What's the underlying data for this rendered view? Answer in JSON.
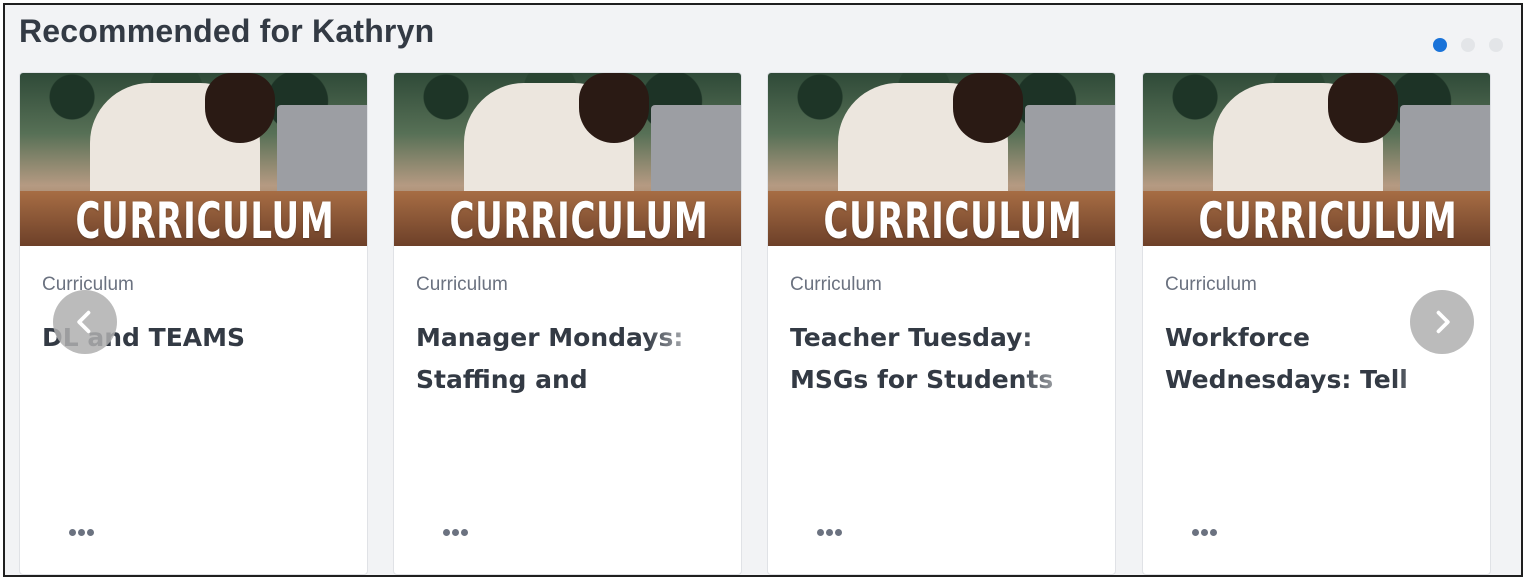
{
  "section": {
    "title": "Recommended for Kathryn"
  },
  "pagination": {
    "pages": 3,
    "active_index": 0,
    "active_color": "#1a73d9",
    "inactive_color": "#e3e5e8"
  },
  "image_caption": "CURRICULUM",
  "cards": [
    {
      "type": "Curriculum",
      "title": "DL and TEAMS"
    },
    {
      "type": "Curriculum",
      "title": "Manager Mondays: Staffing and"
    },
    {
      "type": "Curriculum",
      "title": "Teacher Tuesday: MSGs for Students"
    },
    {
      "type": "Curriculum",
      "title": "Workforce Wednesdays: Tell"
    }
  ],
  "controls": {
    "prev_icon": "chevron-left-icon",
    "next_icon": "chevron-right-icon",
    "menu_icon": "more-horizontal-icon"
  }
}
